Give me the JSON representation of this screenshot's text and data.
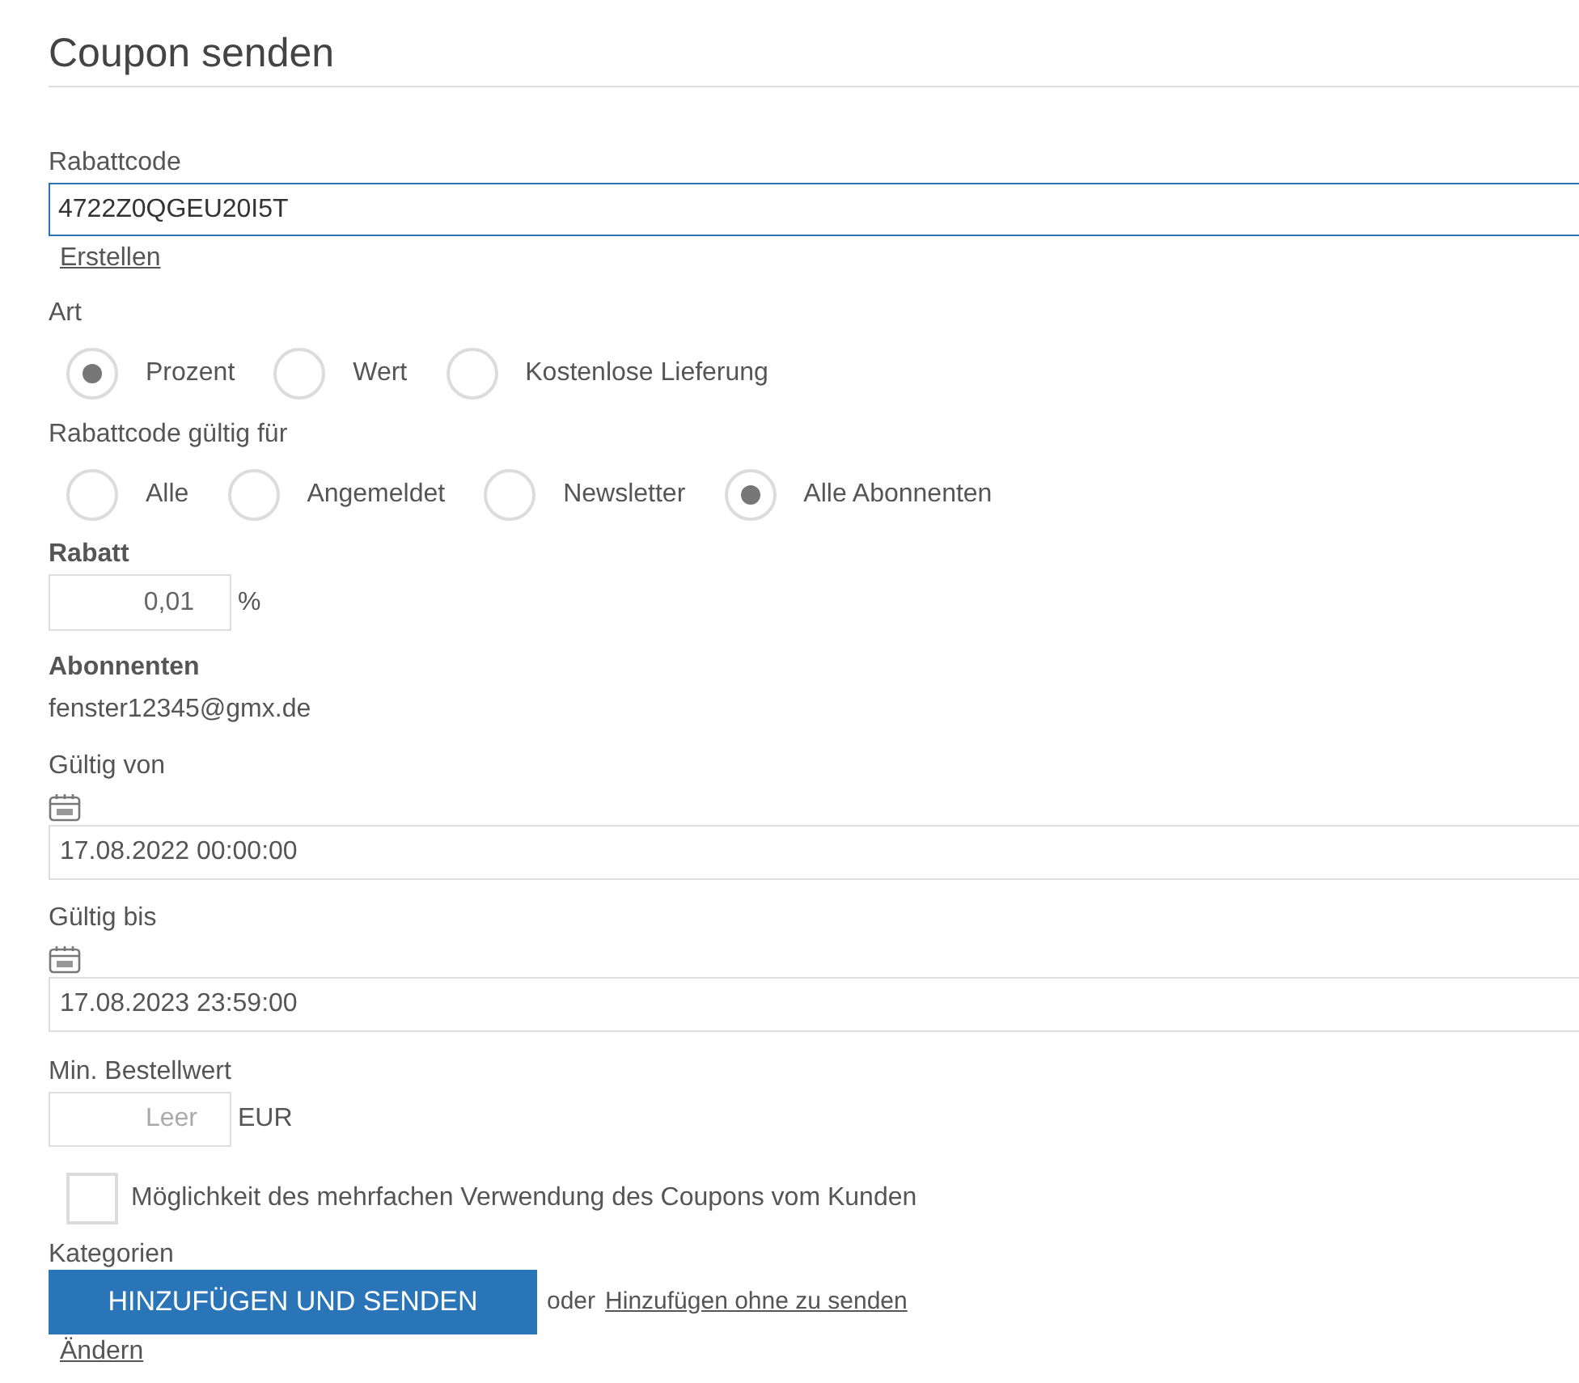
{
  "title": "Coupon senden",
  "code": {
    "label": "Rabattcode",
    "value": "4722Z0QGEU20I5T",
    "link": "Erstellen"
  },
  "type": {
    "label": "Art",
    "options": [
      {
        "label": "Prozent",
        "selected": true
      },
      {
        "label": "Wert",
        "selected": false
      },
      {
        "label": "Kostenlose Lieferung",
        "selected": false
      }
    ]
  },
  "valid_for": {
    "label": "Rabattcode gültig für",
    "options": [
      {
        "label": "Alle",
        "selected": false
      },
      {
        "label": "Angemeldet",
        "selected": false
      },
      {
        "label": "Newsletter",
        "selected": false
      },
      {
        "label": "Alle Abonnenten",
        "selected": true
      }
    ]
  },
  "discount": {
    "label": "Rabatt",
    "value": "0,01",
    "unit": "%"
  },
  "subscribers": {
    "label": "Abonnenten",
    "value": "fenster12345@gmx.de"
  },
  "valid_from": {
    "label": "Gültig von",
    "value": "17.08.2022 00:00:00"
  },
  "valid_to": {
    "label": "Gültig bis",
    "value": "17.08.2023 23:59:00"
  },
  "min_order": {
    "label": "Min. Bestellwert",
    "placeholder": "Leer",
    "unit": "EUR"
  },
  "multi_use": {
    "label": "Möglichkeit des mehrfachen Verwendung des Coupons vom Kunden",
    "checked": false
  },
  "categories": {
    "label": "Kategorien",
    "link": "Ändern"
  },
  "submit": {
    "label": "HINZUFÜGEN UND SENDEN",
    "or": "oder",
    "link": "Hinzufügen ohne zu senden"
  }
}
